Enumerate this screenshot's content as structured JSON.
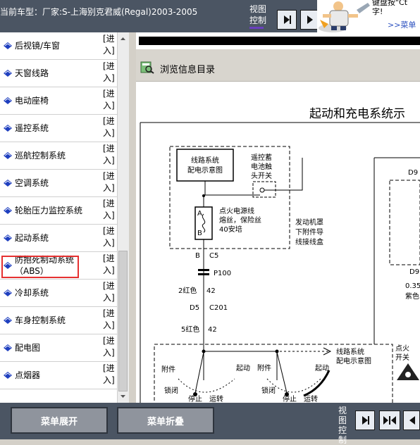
{
  "header": {
    "model_title": "当前车型：厂家:S-上海别克君威(Regal)2003-2005",
    "view_control_label": "视图控制"
  },
  "ad": {
    "text_line1": "键盘按\"Ct",
    "text_line2": "字!",
    "link": ">>菜单"
  },
  "sidebar": {
    "enter_label": "[进入]",
    "items": [
      {
        "label": "后视镜/车窗"
      },
      {
        "label": "天窗线路"
      },
      {
        "label": "电动座椅"
      },
      {
        "label": "遥控系统"
      },
      {
        "label": "巡航控制系统"
      },
      {
        "label": "空调系统"
      },
      {
        "label": "轮胎压力监控系统"
      },
      {
        "label": "起动系统"
      },
      {
        "label": "防抱死制动系统",
        "label2": "（ABS）"
      },
      {
        "label": "冷却系统"
      },
      {
        "label": "车身控制系统"
      },
      {
        "label": "配电图"
      },
      {
        "label": "点烟器"
      }
    ]
  },
  "content": {
    "browse_label": "浏览信息目录",
    "doc_title": "起动和充电系统示"
  },
  "diagram": {
    "box1_l1": "线路系统",
    "box1_l2": "配电示意图",
    "switch_l1": "遥控蓄",
    "switch_l2": "电池触",
    "switch_l3": "头开关",
    "fuse_l1": "点火电源线",
    "fuse_l2": "熔丝，保险丝",
    "fuse_l3": "40安培",
    "fuse_a": "A",
    "fuse_b": "B",
    "engine_l1": "发动机罩",
    "engine_l2": "下附件导",
    "engine_l3": "线接线盒",
    "c5": "B",
    "c5b": "C5",
    "p100": "P100",
    "wire1": "2红色",
    "wire1_num": "42",
    "d5": "D5",
    "c201": "C201",
    "wire2": "5红色",
    "wire2_num": "42",
    "dist_l1": "线路系统",
    "dist_l2": "配电示意图",
    "ign_l1": "点火",
    "ign_l2": "开关",
    "acc1": "附件",
    "start1": "起动",
    "acc2": "附件",
    "start2": "起动",
    "lock1": "锁闭",
    "lock2": "锁闭",
    "off1": "停止",
    "run1": "运转",
    "off2": "停止",
    "run2": "运转",
    "d9a": "D9",
    "d9b": "D9",
    "r035": "0.35",
    "rcolor": "紫色"
  },
  "footer": {
    "expand_label": "菜单展开",
    "collapse_label": "菜单折叠",
    "view_control_label": "视图控制"
  },
  "colors": {
    "toolbar_bg": "#4b5563",
    "highlight_border": "#e53030",
    "icon_blue": "#1f3fbf"
  }
}
